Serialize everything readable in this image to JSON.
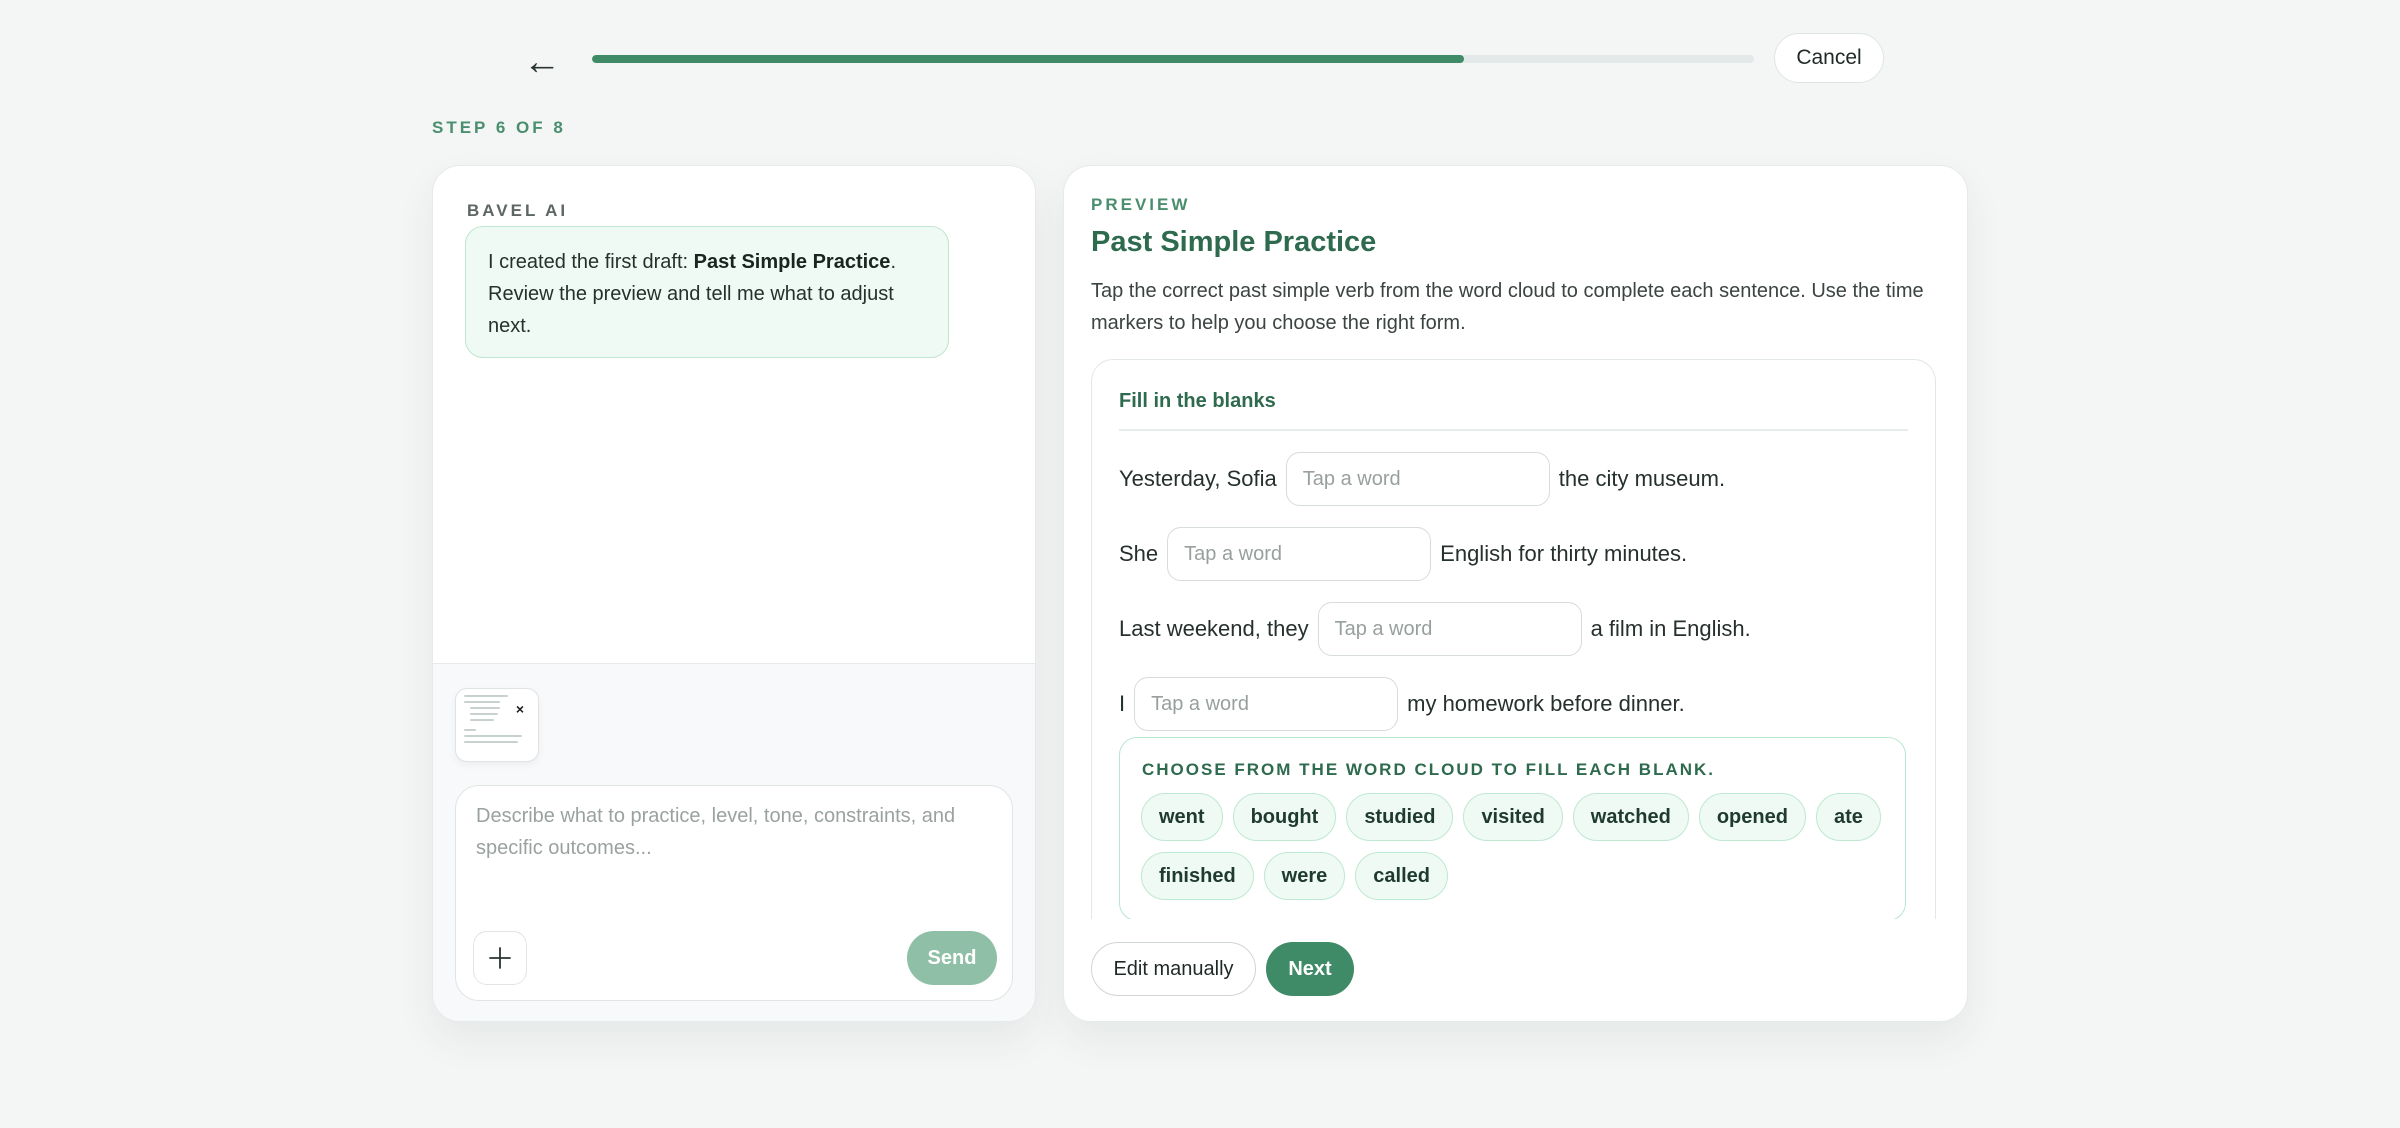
{
  "nav": {
    "back_icon": "←",
    "progress_percent": 75,
    "cancel_label": "Cancel"
  },
  "step_label": "STEP 6 OF 8",
  "chat": {
    "assistant_name": "BAVEL AI",
    "message_prefix": "I created the first draft: ",
    "message_title": "Past Simple Practice",
    "message_suffix": ". Review the preview and tell me what to adjust next.",
    "composer_placeholder": "Describe what to practice, level, tone, constraints, and specific outcomes...",
    "send_label": "Send",
    "attachment_close_icon": "×"
  },
  "preview": {
    "label": "PREVIEW",
    "title": "Past Simple Practice",
    "description": "Tap the correct past simple verb from the word cloud to complete each sentence. Use the time markers to help you choose the right form.",
    "exercise_title": "Fill in the blanks",
    "blank_placeholder": "Tap a word",
    "sentences": [
      {
        "before": "Yesterday, Sofia",
        "after": "the city museum."
      },
      {
        "before": "She",
        "after": "English for thirty minutes."
      },
      {
        "before": "Last weekend, they",
        "after": "a film in English."
      },
      {
        "before": "I",
        "after": "my homework before dinner."
      }
    ],
    "word_cloud_label": "CHOOSE FROM THE WORD CLOUD TO FILL EACH BLANK.",
    "words": [
      "went",
      "bought",
      "studied",
      "visited",
      "watched",
      "opened",
      "ate",
      "finished",
      "were",
      "called"
    ],
    "edit_label": "Edit manually",
    "next_label": "Next"
  },
  "colors": {
    "accent": "#3f8a67",
    "accent_light": "#eefaf3",
    "send_disabled": "#8fbfa6",
    "title_green": "#2e6a4e"
  }
}
